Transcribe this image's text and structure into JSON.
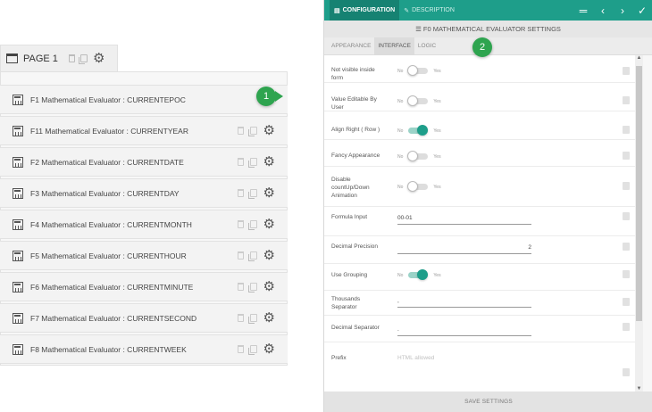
{
  "builder": {
    "page_label": "PAGE 1",
    "rows": [
      {
        "label": "F1 Mathematical Evaluator : CURRENTEPOC",
        "active": true
      },
      {
        "label": "F11 Mathematical Evaluator : CURRENTYEAR",
        "active": false
      },
      {
        "label": "F2 Mathematical Evaluator : CURRENTDATE",
        "active": false
      },
      {
        "label": "F3 Mathematical Evaluator : CURRENTDAY",
        "active": false
      },
      {
        "label": "F4 Mathematical Evaluator : CURRENTMONTH",
        "active": false
      },
      {
        "label": "F5 Mathematical Evaluator : CURRENTHOUR",
        "active": false
      },
      {
        "label": "F6 Mathematical Evaluator : CURRENTMINUTE",
        "active": false
      },
      {
        "label": "F7 Mathematical Evaluator : CURRENTSECOND",
        "active": false
      },
      {
        "label": "F8 Mathematical Evaluator : CURRENTWEEK",
        "active": false
      }
    ]
  },
  "badges": {
    "one": "1",
    "two": "2"
  },
  "panel": {
    "tab_configuration": "CONFIGURATION",
    "tab_description": "DESCRIPTION",
    "title": "F0 MATHEMATICAL EVALUATOR SETTINGS",
    "subtabs": [
      "APPEARANCE",
      "INTERFACE",
      "LOGIC"
    ],
    "active_subtab": "INTERFACE",
    "toggle_no": "No",
    "toggle_yes": "Yes",
    "props": {
      "not_visible": {
        "label": "Not visible inside form",
        "on": false
      },
      "value_editable": {
        "label": "Value Editable By User",
        "on": false
      },
      "align_right": {
        "label": "Align Right ( Row )",
        "on": true
      },
      "fancy": {
        "label": "Fancy Appearance",
        "on": false
      },
      "disable_count": {
        "label": "Disable countUp/Down Animation",
        "on": false
      },
      "formula": {
        "label": "Formula Input",
        "value": "00-01"
      },
      "decimal_precision": {
        "label": "Decimal Precision",
        "value": "2"
      },
      "use_grouping": {
        "label": "Use Grouping",
        "on": true
      },
      "thousands_sep": {
        "label": "Thousands Separator",
        "value": ","
      },
      "decimal_sep": {
        "label": "Decimal Separator",
        "value": "."
      },
      "prefix": {
        "label": "Prefix",
        "placeholder": "HTML allowed"
      }
    },
    "save_label": "SAVE SETTINGS"
  },
  "colors": {
    "accent": "#1e9e8a",
    "badge": "#2ea44f"
  }
}
